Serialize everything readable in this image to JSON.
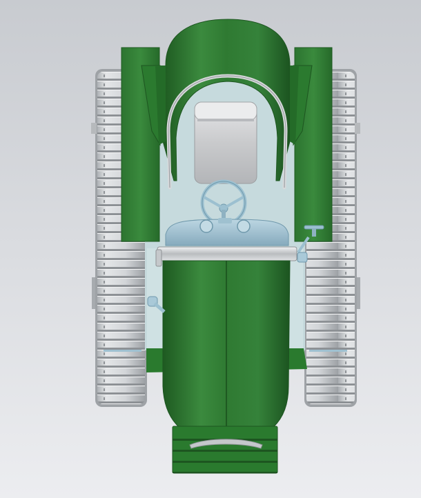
{
  "viewport": {
    "background_top": "#c8cbd0",
    "background_bottom": "#ecedf0"
  },
  "model": {
    "colors": {
      "body_green": "#2f7a32",
      "body_green_dark": "#1f5a22",
      "body_green_light": "#4a9a4c",
      "track_light": "#e2e4e6",
      "track_mid": "#c4c7ca",
      "track_dark": "#9a9ea2",
      "glass": "#c9dde0",
      "dash_blue": "#a9c9d8",
      "dash_blue_dark": "#7fa6b9",
      "seat": "#cfd0d2",
      "chrome": "#d8dadc"
    }
  }
}
